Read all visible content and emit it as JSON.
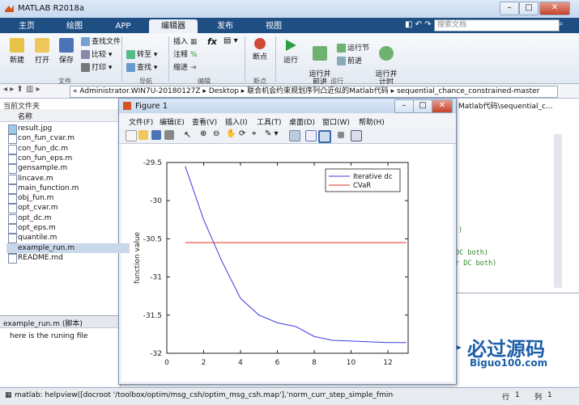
{
  "app": {
    "title": "MATLAB R2018a"
  },
  "colors": {
    "accent": "#1f4e83",
    "series_blue": "#3b3be0",
    "series_red": "#e03030"
  },
  "main_tabs": [
    {
      "label": "主页"
    },
    {
      "label": "绘图"
    },
    {
      "label": "APP"
    },
    {
      "label": "编辑器"
    },
    {
      "label": "发布"
    },
    {
      "label": "视图"
    }
  ],
  "search": {
    "placeholder": "搜索文档"
  },
  "ribbon": {
    "new": "新建",
    "open": "打开",
    "save": "保存",
    "find_files": "查找文件",
    "compare": "比较",
    "print": "打印",
    "insert": "插入",
    "comment": "注释",
    "indent": "缩进",
    "goto": "转至",
    "find": "查找",
    "breakpoints": "断点",
    "run": "运行",
    "run_advance": "运行并\n前进",
    "run_section": "运行节",
    "advance": "前进",
    "run_time": "运行并\n计时",
    "groups": {
      "file": "文件",
      "nav": "导航",
      "edit": "编辑",
      "breakpoints": "断点",
      "run": "运行"
    }
  },
  "address": {
    "path": "« Administrator.WIN7U-20180127Z  ▸  Desktop  ▸  联合机会约束规划序列凸近似的Matlab代码  ▸  sequential_chance_constrained-master"
  },
  "current_folder": {
    "title": "当前文件夹",
    "column": "名称",
    "files": [
      "result.jpg",
      "con_fun_cvar.m",
      "con_fun_dc.m",
      "con_fun_eps.m",
      "gensample.m",
      "lincave.m",
      "main_function.m",
      "obj_fun.m",
      "opt_cvar.m",
      "opt_dc.m",
      "opt_eps.m",
      "quantile.m",
      "example_run.m",
      "README.md"
    ]
  },
  "details": {
    "title": "example_run.m  (脚本)",
    "text": "here is the runing file"
  },
  "editor_bg": {
    "path": "Matlab代码\\sequential_c...",
    "lines": [
      ")",
      "DC both)",
      "r DC both)"
    ]
  },
  "status": {
    "text": "matlab: helpview([docroot '/toolbox/optim/msg_csh/optim_msg_csh.map'],'norm_curr_step_simple_fminc...",
    "row_label": "行",
    "row": "1",
    "col_label": "列",
    "col": "1"
  },
  "watermark": {
    "text": "必过源码",
    "url": "Biguo100.com"
  },
  "figure": {
    "title": "Figure 1",
    "menus": [
      "文件(F)",
      "编辑(E)",
      "查看(V)",
      "插入(I)",
      "工具(T)",
      "桌面(D)",
      "窗口(W)",
      "帮助(H)"
    ]
  },
  "chart_data": {
    "type": "line",
    "title": "",
    "xlabel": "",
    "ylabel": "function value",
    "xlim": [
      0,
      13.1
    ],
    "ylim": [
      -32,
      -29.5
    ],
    "xticks": [
      0,
      2,
      4,
      6,
      8,
      10,
      12
    ],
    "yticks": [
      -29.5,
      -30,
      -30.5,
      -31,
      -31.5,
      -32
    ],
    "ytick_labels": [
      "-29.5",
      "-30",
      "-30.5",
      "-31",
      "-31.5",
      "-32"
    ],
    "legend_position": "top-right",
    "series": [
      {
        "name": "Iterative dc",
        "color": "#3b3be0",
        "x": [
          1,
          2,
          3,
          4,
          5,
          6,
          7,
          8,
          9,
          10,
          11,
          12,
          13
        ],
        "y": [
          -29.55,
          -30.25,
          -30.8,
          -31.28,
          -31.5,
          -31.6,
          -31.65,
          -31.78,
          -31.83,
          -31.84,
          -31.85,
          -31.86,
          -31.86
        ]
      },
      {
        "name": "CVaR",
        "color": "#e03030",
        "x": [
          1,
          13
        ],
        "y": [
          -30.55,
          -30.55
        ]
      }
    ]
  }
}
